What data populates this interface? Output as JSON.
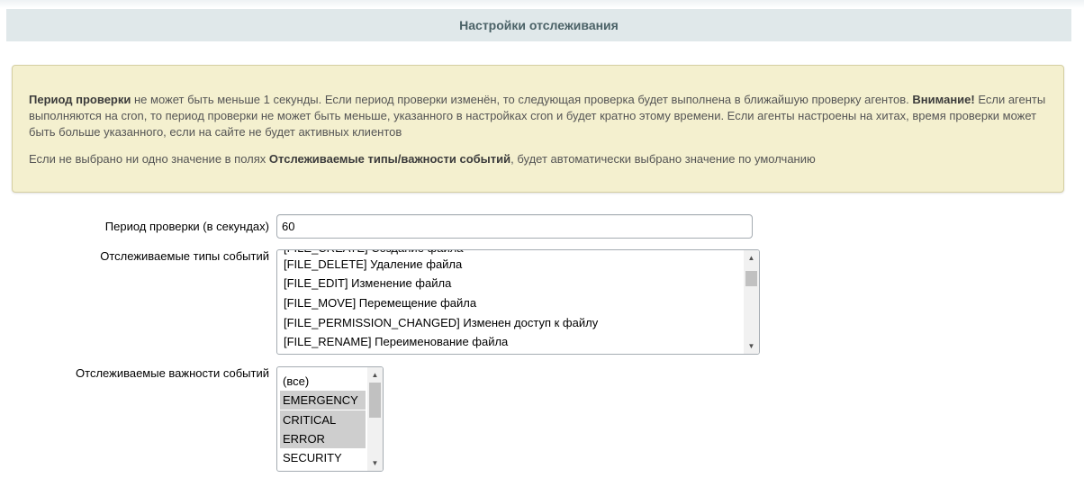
{
  "section": {
    "title": "Настройки отслеживания"
  },
  "notice": {
    "p1_bold_1": "Период проверки",
    "p1_text_1": " не может быть меньше 1 секунды. Если период проверки изменён, то следующая проверка будет выполнена в ближайшую проверку агентов. ",
    "p1_bold_2": "Внимание!",
    "p1_text_2": " Если агенты выполняются на cron, то период проверки не может быть меньше, указанного в настройках cron и будет кратно этому времени. Если агенты настроены на хитах, время проверки может быть больше указанного, если на сайте не будет активных клиентов",
    "p2_text_1": "Если не выбрано ни одно значение в полях ",
    "p2_bold_1": "Отслеживаемые типы/важности событий",
    "p2_text_2": ", будет автоматически выбрано значение по умолчанию"
  },
  "form": {
    "period": {
      "label": "Период проверки (в секундах)",
      "value": "60"
    },
    "event_types": {
      "label": "Отслеживаемые типы событий",
      "partial_option": "[FILE_CREATE] Создание файла",
      "options": [
        {
          "text": "[FILE_DELETE] Удаление файла",
          "selected": false
        },
        {
          "text": "[FILE_EDIT] Изменение файла",
          "selected": false
        },
        {
          "text": "[FILE_MOVE] Перемещение файла",
          "selected": false
        },
        {
          "text": "[FILE_PERMISSION_CHANGED] Изменен доступ к файлу",
          "selected": false
        },
        {
          "text": "[FILE_RENAME] Переименование файла",
          "selected": false
        }
      ]
    },
    "severities": {
      "label": "Отслеживаемые важности событий",
      "options": [
        {
          "text": "(все)",
          "selected": false
        },
        {
          "text": "EMERGENCY",
          "selected": true
        },
        {
          "text": "CRITICAL",
          "selected": true
        },
        {
          "text": "ERROR",
          "selected": true
        },
        {
          "text": "SECURITY",
          "selected": false
        }
      ]
    }
  },
  "icons": {
    "scroll_up": "▲",
    "scroll_down": "▼"
  }
}
